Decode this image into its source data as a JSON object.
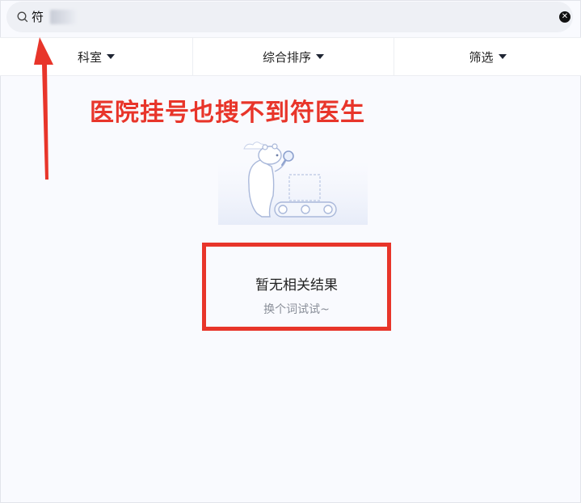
{
  "search": {
    "value": "符",
    "clear_icon": "close-circle-icon"
  },
  "filters": [
    {
      "label": "科室"
    },
    {
      "label": "综合排序"
    },
    {
      "label": "筛选"
    }
  ],
  "annotation": {
    "text": "医院挂号也搜不到符医生",
    "color": "#e8352a"
  },
  "empty_state": {
    "title": "暂无相关结果",
    "hint": "换个词试试~",
    "illustration": "bear-magnifier-illustration"
  },
  "colors": {
    "accent_red": "#e8352a",
    "background": "#f9fafe",
    "search_bg": "#eef0f5"
  }
}
